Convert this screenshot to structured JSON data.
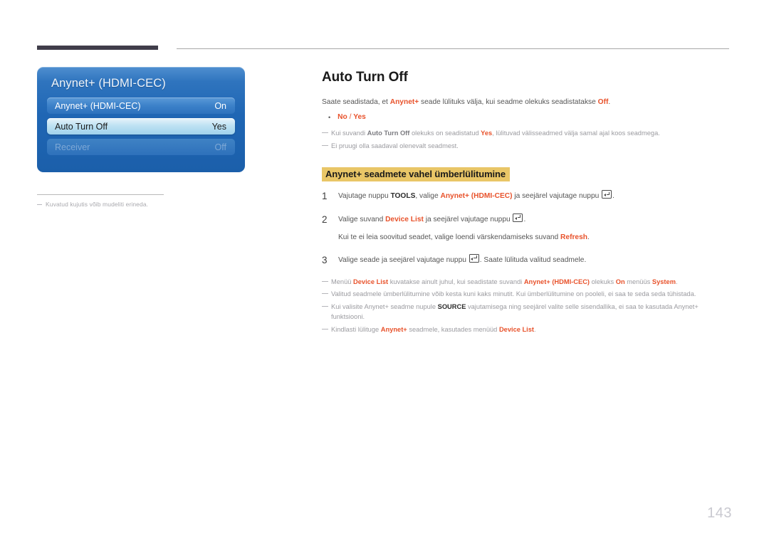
{
  "header": {
    "rule_left_name": "chapter-marker-bar",
    "rule_right_name": "header-divider-line"
  },
  "tv_menu": {
    "title": "Anynet+ (HDMI-CEC)",
    "rows": [
      {
        "label": "Anynet+ (HDMI-CEC)",
        "value": "On",
        "state": "normal"
      },
      {
        "label": "Auto Turn Off",
        "value": "Yes",
        "state": "selected"
      },
      {
        "label": "Receiver",
        "value": "Off",
        "state": "disabled"
      }
    ],
    "caption": "Kuvatud kujutis võib mudeliti erineda."
  },
  "content": {
    "title": "Auto Turn Off",
    "intro": {
      "p1": "Saate seadistada, et ",
      "term1": "Anynet+",
      "p2": " seade lülituks välja, kui seadme olekuks seadistatakse ",
      "term2": "Off",
      "p3": "."
    },
    "bullet": {
      "marker": "•",
      "no": "No",
      "sep": " / ",
      "yes": "Yes"
    },
    "intro_notes": [
      {
        "a": "Kui suvandi ",
        "b": "Auto Turn Off",
        "c": " olekuks on seadistatud ",
        "d": "Yes",
        "e": ", lülituvad välisseadmed välja samal ajal koos seadmega."
      },
      {
        "a": "Ei pruugi olla saadaval olenevalt seadmest.",
        "b": "",
        "c": "",
        "d": "",
        "e": ""
      }
    ],
    "section_heading": "Anynet+ seadmete vahel ümberlülitumine",
    "steps": [
      {
        "num": "1",
        "a": "Vajutage nuppu ",
        "b": "TOOLS",
        "c": ", valige ",
        "d": "Anynet+ (HDMI-CEC)",
        "e": " ja seejärel vajutage nuppu ",
        "f": "."
      },
      {
        "num": "2",
        "a": "Valige suvand ",
        "b": "",
        "c": "",
        "d": "Device List",
        "e": " ja seejärel vajutage nuppu ",
        "f": "."
      },
      {
        "num": "3",
        "a": "Valige seade ja seejärel vajutage nuppu ",
        "b": "",
        "c": "",
        "d": "",
        "e": "",
        "f": ". Saate lülituda valitud seadmele."
      }
    ],
    "substep": {
      "a": "Kui te ei leia soovitud seadet, valige loendi värskendamiseks suvand ",
      "b": "Refresh",
      "c": "."
    },
    "notes": [
      {
        "a": "Menüü ",
        "b": "Device List",
        "c": " kuvatakse ainult juhul, kui seadistate suvandi ",
        "d": "Anynet+ (HDMI-CEC)",
        "e": " olekuks ",
        "f": "On",
        "g": " menüüs ",
        "h": "System",
        "i": "."
      },
      {
        "a": "Valitud seadmele ümberlülitumine võib kesta kuni kaks minutit. Kui ümberlülitumine on pooleli, ei saa te seda seda tühistada.",
        "b": "",
        "c": "",
        "d": "",
        "e": "",
        "f": "",
        "g": "",
        "h": "",
        "i": ""
      },
      {
        "a": "Kui valisite Anynet+ seadme nupule ",
        "b": "SOURCE",
        "c": " vajutamisega ning seejärel valite selle sisendallika, ei saa te kasutada Anynet+ funktsiooni.",
        "d": "",
        "e": "",
        "f": "",
        "g": "",
        "h": "",
        "i": ""
      },
      {
        "a": "Kindlasti lülituge ",
        "b": "Anynet+",
        "c": " seadmele, kasutades menüüd ",
        "d": "Device List",
        "e": ".",
        "f": "",
        "g": "",
        "h": "",
        "i": ""
      }
    ]
  },
  "footer": {
    "page_number": "143"
  },
  "colors": {
    "accent_orange": "#e8522b",
    "heading_highlight": "#e9c667",
    "menu_blue": "#1f66b4",
    "menu_selected": "#bfe2f3",
    "note_gray": "#9b9ba0",
    "page_number_gray": "#c9c9d0",
    "chapter_bar": "#403d4a"
  }
}
